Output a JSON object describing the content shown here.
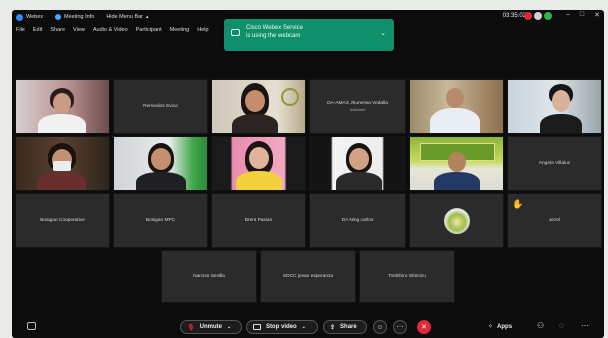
{
  "titlebar": {
    "app": "Webex",
    "meeting_info": "Meeting Info",
    "hide_menu": "Hide Menu Bar",
    "clock": "03:35:02"
  },
  "menu": [
    "File",
    "Edit",
    "Share",
    "View",
    "Audio & Video",
    "Participant",
    "Meeting",
    "Help"
  ],
  "toast": {
    "line1": "Cisco Webex Service",
    "line2": "is using the webcam"
  },
  "participants": {
    "remedios": "Remedios Evica",
    "daamas": "DA-AMAS Jhunessa Vedalla",
    "daamas_sub": "Unlimited",
    "angela": "Angela Villaluz",
    "bosigan_coop": "Bosigan Cooperative",
    "bosigan_mpc": "Bosigan MPC",
    "brent": "Brent Pasian",
    "da_ning": "DA Ning carlos",
    "jezel": "Jezel",
    "narciso": "Narciso Sevilla",
    "sdcc": "SDCC jovan esperanza",
    "toshihiro": "Toshihiro Shimizu"
  },
  "controls": {
    "unmute": "Unmute",
    "stop_video": "Stop video",
    "share": "Share",
    "apps": "Apps"
  },
  "colors": {
    "toast": "#0f8f6a",
    "end_call": "#e0283a",
    "tile": "#2b2b2b"
  }
}
